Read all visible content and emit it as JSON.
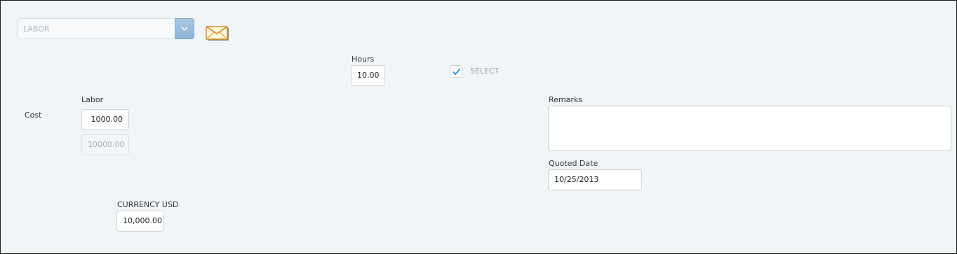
{
  "work_type_select": {
    "value": "LABOR"
  },
  "hours": {
    "label": "Hours",
    "value": "10.00"
  },
  "select_checkbox": {
    "label": "SELECT",
    "checked": true
  },
  "cost": {
    "label": "Cost",
    "labor_label": "Labor",
    "labor_value": "1000.00",
    "labor_total": "10000.00"
  },
  "currency": {
    "label": "CURRENCY USD",
    "value": "10,000.00"
  },
  "remarks": {
    "label": "Remarks",
    "value": ""
  },
  "quoted_date": {
    "label": "Quoted Date",
    "value": "10/25/2013"
  },
  "icons": {
    "dropdown": "chevron-down-icon",
    "email": "envelope-icon"
  },
  "colors": {
    "accent": "#8fb3d8",
    "check": "#2a9fd6",
    "background": "#f2f5f8"
  }
}
